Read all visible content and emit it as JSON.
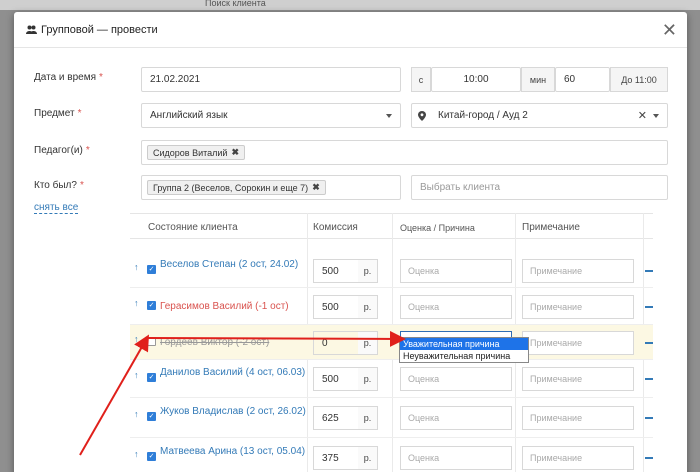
{
  "background": {
    "search_text": "Поиск клиента"
  },
  "modal": {
    "title": "Групповой — провести",
    "title_icon": "users-icon",
    "close_icon": "close-icon"
  },
  "form": {
    "date_label": "Дата и время",
    "date_value": "21.02.2021",
    "time_prefix": "с",
    "time_value": "10:00",
    "min_label": "мин",
    "min_value": "60",
    "until_text": "До 11:00",
    "subject_label": "Предмет",
    "subject_value": "Английский язык",
    "location_icon": "map-pin-icon",
    "location_value": "Китай-город / Ауд 2",
    "teacher_label": "Педагог(и)",
    "teacher_tag": "Сидоров Виталий",
    "who_label": "Кто был?",
    "who_tag": "Группа 2 (Веселов, Сорокин и еще 7)",
    "client_placeholder": "Выбрать клиента",
    "uncheck_all": "снять все"
  },
  "table": {
    "headers": {
      "state": "Состояние клиента",
      "commission": "Комиссия",
      "grade": "Оценка / Причина",
      "note": "Примечание"
    },
    "currency": "р.",
    "grade_placeholder": "Оценка",
    "note_placeholder": "Примечание",
    "rows": [
      {
        "name": "Веселов Степан (2 ост, 24.02)",
        "commission": "500",
        "status": "ok"
      },
      {
        "name": "Герасимов Василий (-1 ост)",
        "commission": "500",
        "status": "debt"
      },
      {
        "name": "Гордеев Виктор (-2 ост)",
        "commission": "0",
        "status": "absent",
        "reason": "Уважительная при"
      },
      {
        "name": "Данилов Василий (4 ост, 06.03)",
        "commission": "500",
        "status": "ok"
      },
      {
        "name": "Жуков Владислав (2 ост, 26.02)",
        "commission": "625",
        "status": "ok"
      },
      {
        "name": "Матвеева Арина (13 ост, 05.04)",
        "commission": "375",
        "status": "ok"
      }
    ],
    "dropdown_options": [
      "Уважительная причина",
      "Неуважительная причина"
    ]
  },
  "colors": {
    "accent": "#337ab7",
    "danger": "#d9534f",
    "highlight": "#fcf8e3",
    "arrow": "#e0201b"
  }
}
